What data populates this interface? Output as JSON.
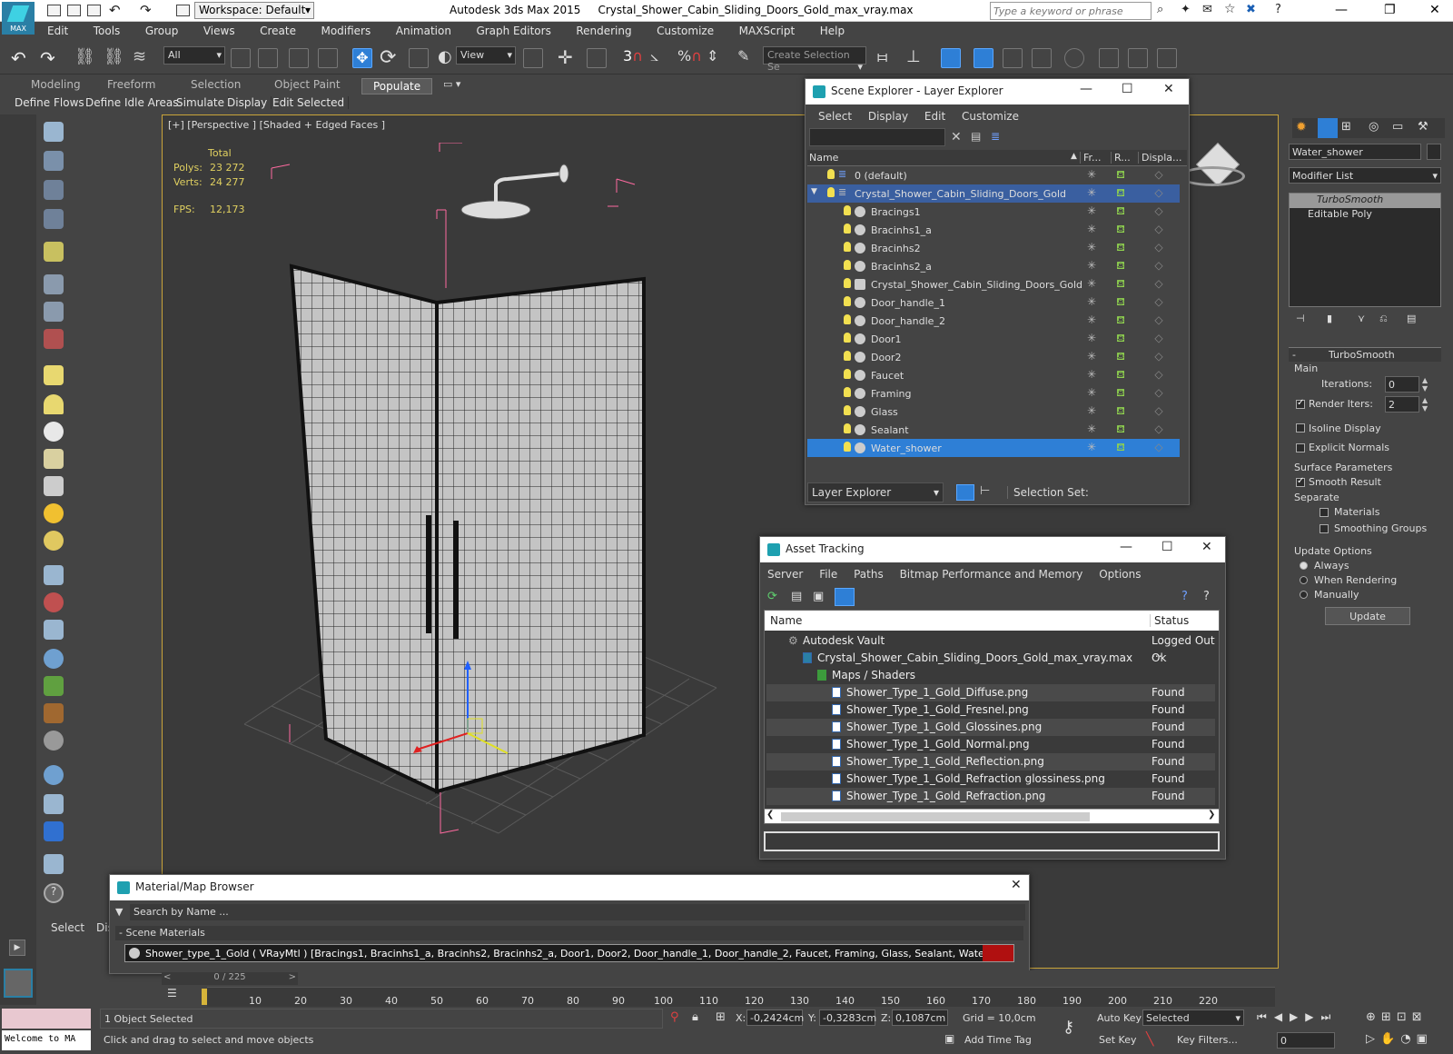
{
  "titlebar": {
    "workspace": "Workspace: Default",
    "app_name": "Autodesk 3ds Max  2015",
    "file_name": "Crystal_Shower_Cabin_Sliding_Doors_Gold_max_vray.max",
    "search_placeholder": "Type a keyword or phrase"
  },
  "menu": [
    "Edit",
    "Tools",
    "Group",
    "Views",
    "Create",
    "Modifiers",
    "Animation",
    "Graph Editors",
    "Rendering",
    "Customize",
    "MAXScript",
    "Help"
  ],
  "toolbar": {
    "filter_value": "All",
    "ref_coord": "View",
    "selection_set_placeholder": "Create Selection Se",
    "snap_3": "3",
    "snap_pct": "%"
  },
  "ribbon": {
    "tabs": [
      "Modeling",
      "Freeform",
      "Selection",
      "Object Paint",
      "Populate"
    ],
    "subtabs": [
      "Define Flows",
      "Define Idle Areas",
      "Simulate",
      "Display",
      "Edit Selected"
    ]
  },
  "viewport": {
    "label": "[+] [Perspective ] [Shaded + Edged Faces ]",
    "stats_total": "Total",
    "polys_label": "Polys:",
    "polys_value": "23 272",
    "verts_label": "Verts:",
    "verts_value": "24 277",
    "fps_label": "FPS:",
    "fps_value": "12,173"
  },
  "scene_explorer": {
    "title": "Scene Explorer - Layer Explorer",
    "menu": [
      "Select",
      "Display",
      "Edit",
      "Customize"
    ],
    "columns": [
      "Name",
      "Fr...",
      "R...",
      "Displa..."
    ],
    "layers": [
      {
        "name": "0 (default)",
        "indent": 0
      },
      {
        "name": "Crystal_Shower_Cabin_Sliding_Doors_Gold",
        "indent": 0,
        "state": "parent"
      }
    ],
    "objects": [
      "Bracings1",
      "Bracinhs1_a",
      "Bracinhs2",
      "Bracinhs2_a",
      "Crystal_Shower_Cabin_Sliding_Doors_Gold",
      "Door_handle_1",
      "Door_handle_2",
      "Door1",
      "Door2",
      "Faucet",
      "Framing",
      "Glass",
      "Sealant",
      "Water_shower"
    ],
    "selected_object": "Water_shower",
    "footer_mode": "Layer Explorer",
    "selection_set_label": "Selection Set:"
  },
  "asset_tracking": {
    "title": "Asset Tracking",
    "menu": [
      "Server",
      "File",
      "Paths",
      "Bitmap Performance and Memory",
      "Options"
    ],
    "columns": [
      "Name",
      "Status"
    ],
    "rows": [
      {
        "name": "Autodesk Vault",
        "status": "Logged Out ..."
      },
      {
        "name": "Crystal_Shower_Cabin_Sliding_Doors_Gold_max_vray.max",
        "status": "Ok"
      },
      {
        "name": "Maps / Shaders",
        "status": ""
      },
      {
        "name": "Shower_Type_1_Gold_Diffuse.png",
        "status": "Found"
      },
      {
        "name": "Shower_Type_1_Gold_Fresnel.png",
        "status": "Found"
      },
      {
        "name": "Shower_Type_1_Gold_Glossines.png",
        "status": "Found"
      },
      {
        "name": "Shower_Type_1_Gold_Normal.png",
        "status": "Found"
      },
      {
        "name": "Shower_Type_1_Gold_Reflection.png",
        "status": "Found"
      },
      {
        "name": "Shower_Type_1_Gold_Refraction glossiness.png",
        "status": "Found"
      },
      {
        "name": "Shower_Type_1_Gold_Refraction.png",
        "status": "Found"
      }
    ]
  },
  "material_browser": {
    "title": "Material/Map Browser",
    "search_placeholder": "Search by Name ...",
    "section": "- Scene Materials",
    "material": "Shower_type_1_Gold  ( VRayMtl ) [Bracings1, Bracinhs1_a, Bracinhs2, Bracinhs2_a, Door1, Door2, Door_handle_1, Door_handle_2, Faucet, Framing, Glass, Sealant, Water_shower]"
  },
  "command_panel": {
    "object_name": "Water_shower",
    "modifier_list": "Modifier List",
    "stack": [
      "TurboSmooth",
      "Editable Poly"
    ],
    "rollout_title": "TurboSmooth",
    "main_group": "Main",
    "iterations_label": "Iterations:",
    "iterations_value": "0",
    "render_iters_label": "Render Iters:",
    "render_iters_value": "2",
    "isoline": "Isoline Display",
    "explicit_normals": "Explicit Normals",
    "surface_params": "Surface Parameters",
    "smooth_result": "Smooth Result",
    "separate": "Separate",
    "materials": "Materials",
    "smoothing_groups": "Smoothing Groups",
    "update_options": "Update Options",
    "always": "Always",
    "when_rendering": "When Rendering",
    "manually": "Manually",
    "update_button": "Update"
  },
  "timeline": {
    "frame_counter": "0 / 225",
    "ticks": [
      "10",
      "20",
      "30",
      "40",
      "50",
      "60",
      "70",
      "80",
      "90",
      "100",
      "110",
      "120",
      "130",
      "140",
      "150",
      "160",
      "170",
      "180",
      "190",
      "200",
      "210",
      "220"
    ]
  },
  "statusbar": {
    "maxscript": "Welcome to MA",
    "selected_count": "1 Object Selected",
    "hint": "Click and drag to select and move objects",
    "x_label": "X:",
    "x_value": "-0,2424cm",
    "y_label": "Y:",
    "y_value": "-0,3283cm",
    "z_label": "Z:",
    "z_value": "0,1087cm",
    "grid": "Grid = 10,0cm",
    "add_time_tag": "Add Time Tag",
    "auto_key": "Auto Key",
    "set_key": "Set Key",
    "key_mode": "Selected",
    "key_filters": "Key Filters...",
    "frame_value": "0",
    "left_select": "Select",
    "left_dis": "Dis"
  }
}
